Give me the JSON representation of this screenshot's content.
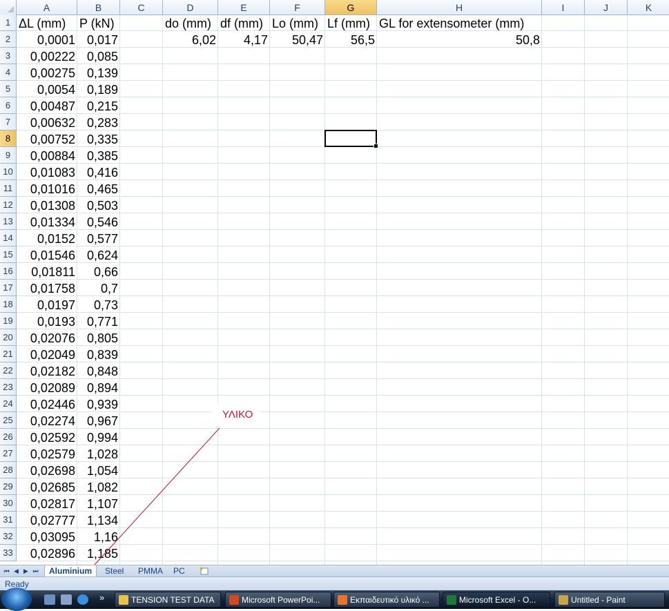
{
  "columns": [
    "A",
    "B",
    "C",
    "D",
    "E",
    "F",
    "G",
    "H",
    "I",
    "J",
    "K"
  ],
  "selected_column": "G",
  "rows": [
    "1",
    "2",
    "3",
    "4",
    "5",
    "6",
    "7",
    "8",
    "9",
    "10",
    "11",
    "12",
    "13",
    "14",
    "15",
    "16",
    "17",
    "18",
    "19",
    "20",
    "21",
    "22",
    "23",
    "24",
    "25",
    "26",
    "27",
    "28",
    "29",
    "30",
    "31",
    "32",
    "33"
  ],
  "selected_row": "8",
  "header_row": {
    "A": "ΔL (mm)",
    "B": "P (kN)",
    "D": "do (mm)",
    "E": "df (mm)",
    "F": "Lo (mm)",
    "G": "Lf (mm)",
    "H": "GL for extensometer (mm)"
  },
  "row2_params": {
    "D": "6,02",
    "E": "4,17",
    "F": "50,47",
    "G": "56,5",
    "H": "50,8"
  },
  "data_rows": [
    {
      "dl": "0,0001",
      "p": "0,017"
    },
    {
      "dl": "0,00222",
      "p": "0,085"
    },
    {
      "dl": "0,00275",
      "p": "0,139"
    },
    {
      "dl": "0,0054",
      "p": "0,189"
    },
    {
      "dl": "0,00487",
      "p": "0,215"
    },
    {
      "dl": "0,00632",
      "p": "0,283"
    },
    {
      "dl": "0,00752",
      "p": "0,335"
    },
    {
      "dl": "0,00884",
      "p": "0,385"
    },
    {
      "dl": "0,01083",
      "p": "0,416"
    },
    {
      "dl": "0,01016",
      "p": "0,465"
    },
    {
      "dl": "0,01308",
      "p": "0,503"
    },
    {
      "dl": "0,01334",
      "p": "0,546"
    },
    {
      "dl": "0,0152",
      "p": "0,577"
    },
    {
      "dl": "0,01546",
      "p": "0,624"
    },
    {
      "dl": "0,01811",
      "p": "0,66"
    },
    {
      "dl": "0,01758",
      "p": "0,7"
    },
    {
      "dl": "0,0197",
      "p": "0,73"
    },
    {
      "dl": "0,0193",
      "p": "0,771"
    },
    {
      "dl": "0,02076",
      "p": "0,805"
    },
    {
      "dl": "0,02049",
      "p": "0,839"
    },
    {
      "dl": "0,02182",
      "p": "0,848"
    },
    {
      "dl": "0,02089",
      "p": "0,894"
    },
    {
      "dl": "0,02446",
      "p": "0,939"
    },
    {
      "dl": "0,02274",
      "p": "0,967"
    },
    {
      "dl": "0,02592",
      "p": "0,994"
    },
    {
      "dl": "0,02579",
      "p": "1,028"
    },
    {
      "dl": "0,02698",
      "p": "1,054"
    },
    {
      "dl": "0,02685",
      "p": "1,082"
    },
    {
      "dl": "0,02817",
      "p": "1,107"
    },
    {
      "dl": "0,02777",
      "p": "1,134"
    },
    {
      "dl": "0,03095",
      "p": "1,16"
    },
    {
      "dl": "0,02896",
      "p": "1,185"
    }
  ],
  "comment": {
    "text": "ΥΛΙΚΟ",
    "color": "#c8102e"
  },
  "sheet_tabs": [
    {
      "label": "Aluminium",
      "active": true
    },
    {
      "label": "Steel",
      "active": false
    },
    {
      "label": "PMMA",
      "active": false
    },
    {
      "label": "PC",
      "active": false
    }
  ],
  "status": "Ready",
  "taskbar": {
    "quicklaunch_more": "»",
    "tasks": [
      {
        "label": "TENSION TEST DATA",
        "icon": "folder-icon",
        "color": "#e8c34a"
      },
      {
        "label": "Microsoft PowerPoi...",
        "icon": "powerpoint-icon",
        "color": "#d04a1d"
      },
      {
        "label": "Εκπαιδευτικό υλικό ...",
        "icon": "firefox-icon",
        "color": "#e8732a"
      },
      {
        "label": "Microsoft Excel - O...",
        "icon": "excel-icon",
        "color": "#1f7a3a",
        "active": true
      },
      {
        "label": "Untitled - Paint",
        "icon": "paint-icon",
        "color": "#c9a24a"
      }
    ]
  }
}
